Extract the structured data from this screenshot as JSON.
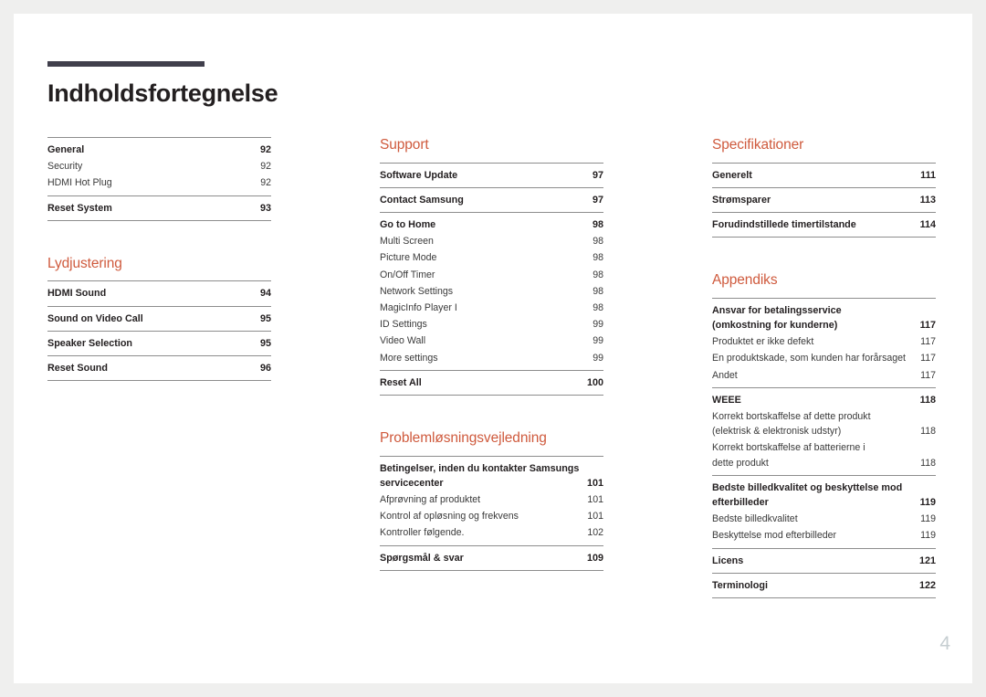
{
  "document": {
    "title": "Indholdsfortegnelse",
    "folio": "4",
    "accent_color": "#cf5a3d",
    "rule_color": "#403f4c",
    "text_color": "#231f20",
    "folio_color": "#c6ced1",
    "page_background": "#ffffff",
    "canvas_background": "#efefee"
  },
  "columns": [
    {
      "name": "column-left",
      "sections": [
        {
          "heading": null,
          "groups": [
            {
              "entries": [
                {
                  "label": "General",
                  "page": "92",
                  "level": 1
                },
                {
                  "label": "Security",
                  "page": "92",
                  "level": 2
                },
                {
                  "label": "HDMI Hot Plug",
                  "page": "92",
                  "level": 2
                }
              ]
            },
            {
              "entries": [
                {
                  "label": "Reset System",
                  "page": "93",
                  "level": 1
                }
              ]
            }
          ]
        },
        {
          "heading": "Lydjustering",
          "groups": [
            {
              "entries": [
                {
                  "label": "HDMI Sound",
                  "page": "94",
                  "level": 1
                }
              ]
            },
            {
              "entries": [
                {
                  "label": "Sound on Video Call",
                  "page": "95",
                  "level": 1
                }
              ]
            },
            {
              "entries": [
                {
                  "label": "Speaker Selection",
                  "page": "95",
                  "level": 1
                }
              ]
            },
            {
              "entries": [
                {
                  "label": "Reset Sound",
                  "page": "96",
                  "level": 1
                }
              ]
            }
          ]
        }
      ]
    },
    {
      "name": "column-middle",
      "sections": [
        {
          "heading": "Support",
          "groups": [
            {
              "entries": [
                {
                  "label": "Software Update",
                  "page": "97",
                  "level": 1
                }
              ]
            },
            {
              "entries": [
                {
                  "label": "Contact Samsung",
                  "page": "97",
                  "level": 1
                }
              ]
            },
            {
              "entries": [
                {
                  "label": "Go to Home",
                  "page": "98",
                  "level": 1
                },
                {
                  "label": "Multi Screen",
                  "page": "98",
                  "level": 2
                },
                {
                  "label": "Picture Mode",
                  "page": "98",
                  "level": 2
                },
                {
                  "label": "On/Off Timer",
                  "page": "98",
                  "level": 2
                },
                {
                  "label": "Network Settings",
                  "page": "98",
                  "level": 2
                },
                {
                  "label": "MagicInfo Player I",
                  "page": "98",
                  "level": 2
                },
                {
                  "label": "ID Settings",
                  "page": "99",
                  "level": 2
                },
                {
                  "label": "Video Wall",
                  "page": "99",
                  "level": 2
                },
                {
                  "label": "More settings",
                  "page": "99",
                  "level": 2
                }
              ]
            },
            {
              "entries": [
                {
                  "label": "Reset All",
                  "page": "100",
                  "level": 1
                }
              ]
            }
          ]
        },
        {
          "heading": "Problemløsningsvejledning",
          "groups": [
            {
              "entries": [
                {
                  "label": "Betingelser, inden du kontakter Samsungs",
                  "label2": "servicecenter",
                  "page": "101",
                  "level": 1,
                  "wrap": true
                },
                {
                  "label": "Afprøvning af produktet",
                  "page": "101",
                  "level": 2
                },
                {
                  "label": "Kontrol af opløsning og frekvens",
                  "page": "101",
                  "level": 2
                },
                {
                  "label": "Kontroller følgende.",
                  "page": "102",
                  "level": 2
                }
              ]
            },
            {
              "entries": [
                {
                  "label": "Spørgsmål & svar",
                  "page": "109",
                  "level": 1
                }
              ]
            }
          ]
        }
      ]
    },
    {
      "name": "column-right",
      "sections": [
        {
          "heading": "Specifikationer",
          "groups": [
            {
              "entries": [
                {
                  "label": "Generelt",
                  "page": "111",
                  "level": 1
                }
              ]
            },
            {
              "entries": [
                {
                  "label": "Strømsparer",
                  "page": "113",
                  "level": 1
                }
              ]
            },
            {
              "entries": [
                {
                  "label": "Forudindstillede timertilstande",
                  "page": "114",
                  "level": 1
                }
              ]
            }
          ]
        },
        {
          "heading": "Appendiks",
          "groups": [
            {
              "entries": [
                {
                  "label": "Ansvar for betalingsservice",
                  "label2": "(omkostning for kunderne)",
                  "page": "117",
                  "level": 1,
                  "wrap": true
                },
                {
                  "label": "Produktet er ikke defekt",
                  "page": "117",
                  "level": 2
                },
                {
                  "label": "En produktskade, som kunden har forårsaget",
                  "page": "117",
                  "level": 2
                },
                {
                  "label": "Andet",
                  "page": "117",
                  "level": 2
                }
              ]
            },
            {
              "entries": [
                {
                  "label": "WEEE",
                  "page": "118",
                  "level": 1
                },
                {
                  "label": "Korrekt bortskaffelse af dette produkt",
                  "label2": "(elektrisk & elektronisk udstyr)",
                  "page": "118",
                  "level": 2,
                  "wrap": true
                },
                {
                  "label": "Korrekt bortskaffelse af batterierne i",
                  "label2": "dette produkt",
                  "page": "118",
                  "level": 2,
                  "wrap": true
                }
              ]
            },
            {
              "entries": [
                {
                  "label": "Bedste billedkvalitet og beskyttelse mod",
                  "label2": "efterbilleder",
                  "page": "119",
                  "level": 1,
                  "wrap": true
                },
                {
                  "label": "Bedste billedkvalitet",
                  "page": "119",
                  "level": 2
                },
                {
                  "label": "Beskyttelse mod efterbilleder",
                  "page": "119",
                  "level": 2
                }
              ]
            },
            {
              "entries": [
                {
                  "label": "Licens",
                  "page": "121",
                  "level": 1
                }
              ]
            },
            {
              "entries": [
                {
                  "label": "Terminologi",
                  "page": "122",
                  "level": 1
                }
              ]
            }
          ]
        }
      ]
    }
  ]
}
